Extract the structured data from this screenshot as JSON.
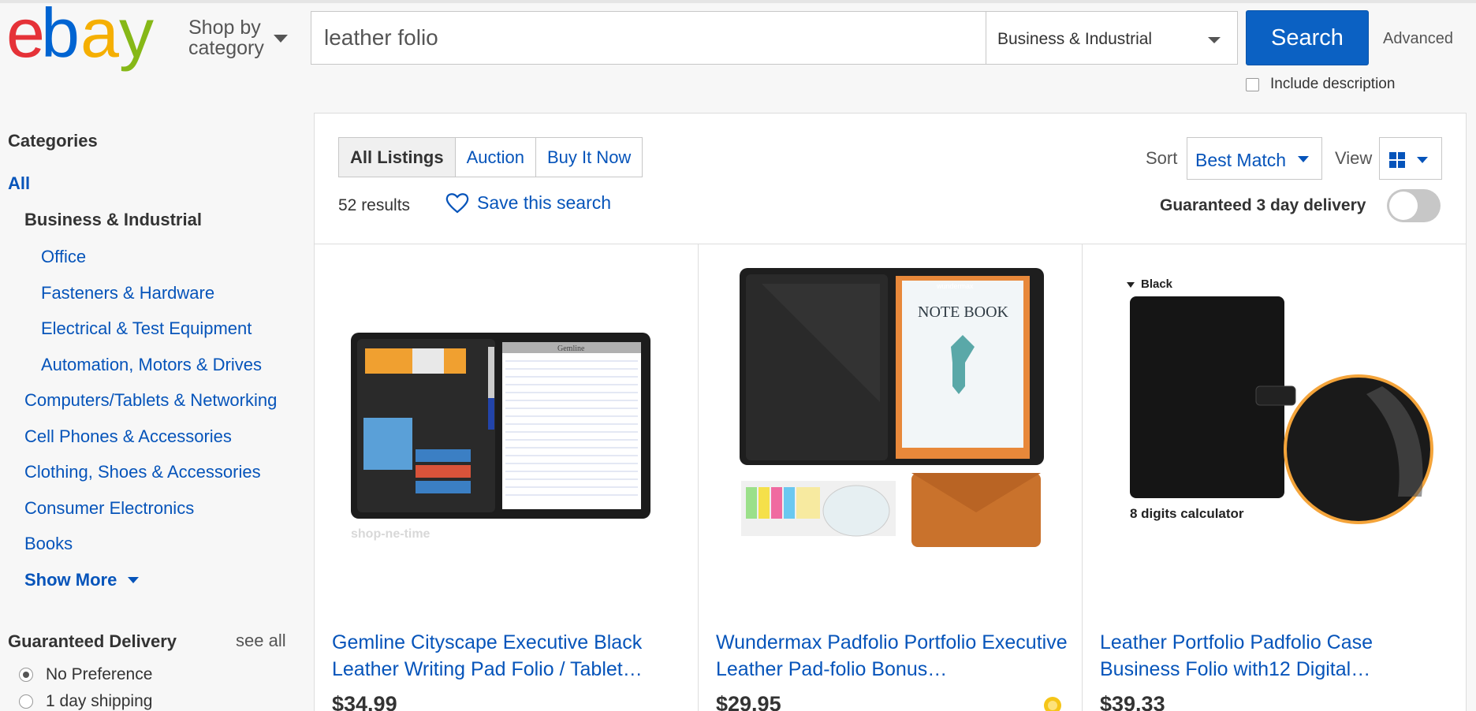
{
  "header": {
    "logo_letters": [
      "e",
      "b",
      "a",
      "y"
    ],
    "logo_colors": [
      "#e53238",
      "#0064d2",
      "#f5af02",
      "#86b817"
    ],
    "shop_by_line1": "Shop by",
    "shop_by_line2": "category",
    "search_value": "leather folio",
    "category_selected": "Business & Industrial",
    "search_button": "Search",
    "advanced_link": "Advanced",
    "include_description": "Include description"
  },
  "sidebar": {
    "categories_heading": "Categories",
    "all_link": "All",
    "current_category": "Business & Industrial",
    "subcategories": [
      "Office",
      "Fasteners & Hardware",
      "Electrical & Test Equipment",
      "Automation, Motors & Drives"
    ],
    "other_categories": [
      "Computers/Tablets & Networking",
      "Cell Phones & Accessories",
      "Clothing, Shoes & Accessories",
      "Consumer Electronics",
      "Books"
    ],
    "show_more": "Show More",
    "delivery_heading": "Guaranteed Delivery",
    "see_all": "see all",
    "delivery_options": [
      {
        "label": "No Preference",
        "selected": true
      },
      {
        "label": "1 day shipping",
        "selected": false
      }
    ]
  },
  "toolbar": {
    "tabs": [
      {
        "label": "All Listings",
        "active": true
      },
      {
        "label": "Auction",
        "active": false
      },
      {
        "label": "Buy It Now",
        "active": false
      }
    ],
    "results_count": "52 results",
    "save_search": "Save this search",
    "sort_label": "Sort",
    "sort_value": "Best Match",
    "view_label": "View",
    "view_icon": "grid-icon",
    "guaranteed_label": "Guaranteed 3 day delivery",
    "guaranteed_on": false
  },
  "listings": [
    {
      "title": "Gemline Cityscape Executive Black Leather Writing Pad Folio / Tablet…",
      "price": "$34.99",
      "image_text": "shop-ne-time",
      "image_header": "Gemline"
    },
    {
      "title": "Wundermax Padfolio Portfolio Executive Leather Pad-folio Bonus…",
      "price": "$29.95",
      "image_text": "NOTE BOOK",
      "image_brand": "wundermax"
    },
    {
      "title": "Leather Portfolio Padfolio Case Business Folio with12 Digital…",
      "price": "$39.33",
      "image_text": "8 digits calculator",
      "image_header": "Black"
    }
  ],
  "colors": {
    "link": "#0654ba",
    "button": "#0b61c3"
  }
}
